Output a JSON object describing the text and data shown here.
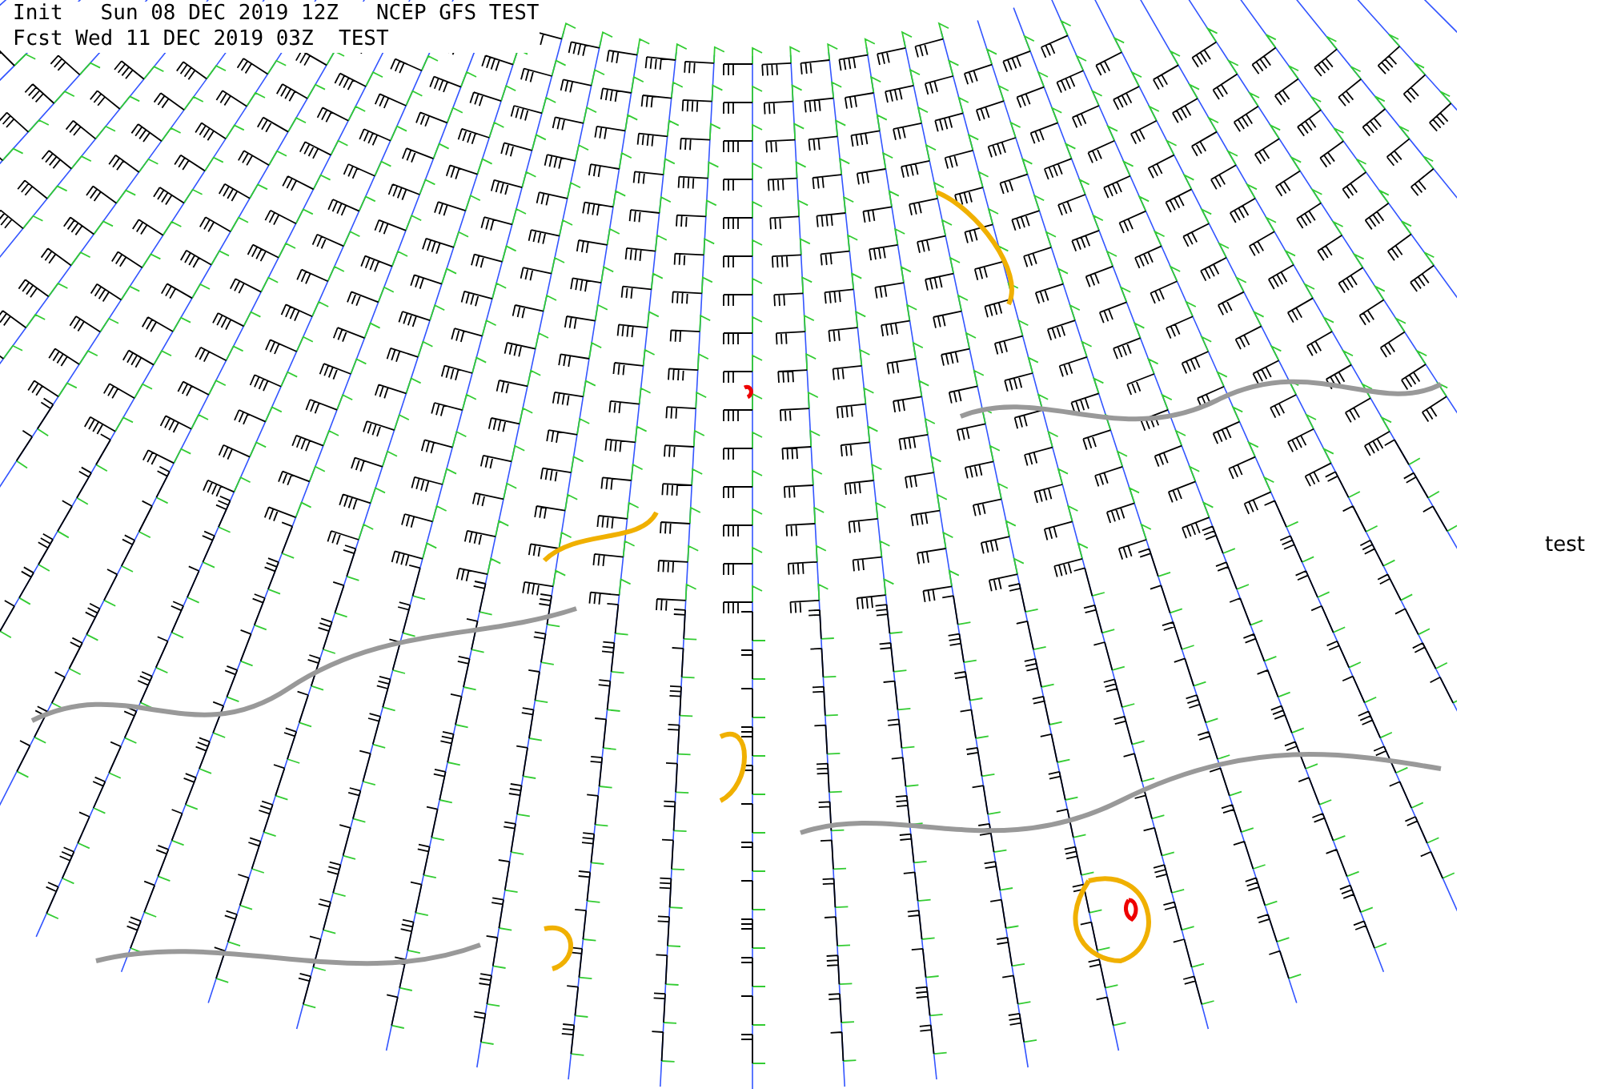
{
  "header": {
    "lines": [
      "Init   Sun 08 DEC 2019 12Z   NCEP GFS TEST",
      "Fcst Wed 11 DEC 2019 03Z  TEST"
    ]
  },
  "side_label": "test"
}
